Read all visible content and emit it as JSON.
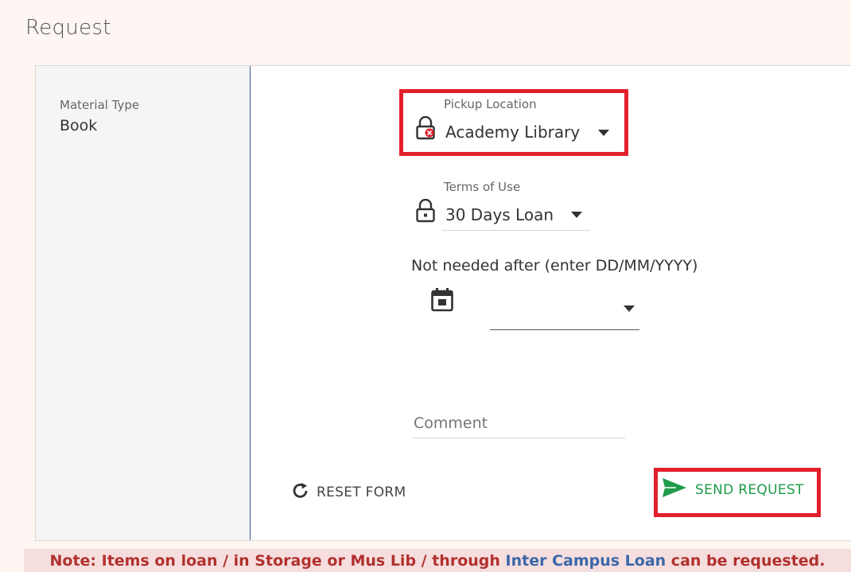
{
  "page": {
    "title": "Request"
  },
  "left_panel": {
    "material_type_label": "Material Type",
    "material_type_value": "Book"
  },
  "pickup": {
    "label": "Pickup Location",
    "value": "Academy Library"
  },
  "terms": {
    "label": "Terms of Use",
    "value": "30 Days Loan"
  },
  "not_needed": {
    "label": "Not needed after (enter DD/MM/YYYY)",
    "value": ""
  },
  "comment": {
    "placeholder": "Comment"
  },
  "actions": {
    "reset_label": "RESET FORM",
    "send_label": "SEND REQUEST"
  },
  "note": {
    "prefix": "Note: Items on loan / in Storage or Mus Lib / through ",
    "link": "Inter Campus Loan",
    "suffix": " can be requested."
  },
  "colors": {
    "highlight": "#e2202c",
    "send": "#1f9b4a",
    "note_text": "#b1312e",
    "note_link": "#3b67a8"
  }
}
